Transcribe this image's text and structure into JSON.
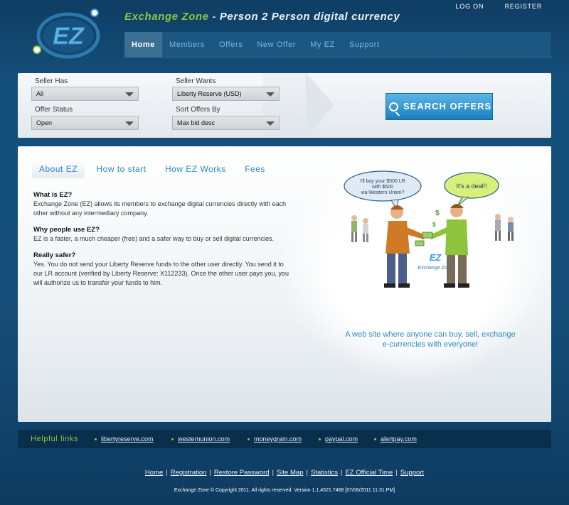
{
  "header": {
    "brand": "Exchange Zone",
    "slogan_sep": " - ",
    "slogan": "Person 2 Person digital currency",
    "logo_text": "EZ",
    "top_links": [
      "LOG ON",
      "REGISTER"
    ]
  },
  "nav": {
    "items": [
      "Home",
      "Members",
      "Offers",
      "New Offer",
      "My EZ",
      "Support"
    ],
    "active": "Home"
  },
  "search": {
    "seller_has_label": "Seller Has",
    "seller_has_value": "All",
    "seller_wants_label": "Seller Wants",
    "seller_wants_value": "Liberty Reserve (USD)",
    "offer_status_label": "Offer Status",
    "offer_status_value": "Open",
    "sort_label": "Sort Offers By",
    "sort_value": "Max bid desc",
    "button": "SEARCH OFFERS"
  },
  "tabs": [
    "About EZ",
    "How to start",
    "How EZ Works",
    "Fees"
  ],
  "faq": [
    {
      "q": "What is EZ?",
      "a": "Exchange Zone (EZ) allows its members to exchange digital currencies directly with each other without any intermediary company."
    },
    {
      "q": "Why people use EZ?",
      "a": "EZ is a faster, a much cheaper (free) and a safer way to buy or sell digital currencies."
    },
    {
      "q": "Really safer?",
      "a": "Yes. You do not send your Liberty Reserve funds to the other user directly. You send it to our LR account (verified by Liberty Reserve: X112233). Once the other user pays you, you will authorize us to transfer your funds to him."
    }
  ],
  "illustration": {
    "bubble_left": [
      "I'll buy your $500 LR",
      "with $500",
      "via Western Union?"
    ],
    "bubble_right": "It's a deal!!",
    "badge": "Exchange Zone",
    "badge_logo": "EZ"
  },
  "tagline": [
    "A web site where anyone can buy, sell, exchange",
    "e-currencies with everyone!"
  ],
  "helpful": {
    "title": "Helpful links",
    "links": [
      "libertyreserve.com",
      "westernunion.com",
      "moneygram.com",
      "paypal.com",
      "alertpay.com"
    ]
  },
  "footer": {
    "links": [
      "Home",
      "Registration",
      "Restore Password",
      "Site Map",
      "Statistics",
      "EZ Official Time",
      "Support"
    ],
    "copyright": "Exchange Zone © Copyright 2011. All rights reserved. Version 1.1.4521.7468 [07/06/2011 11:31 PM]"
  },
  "colors": {
    "background": "#14507c",
    "accent_green": "#8dc63f",
    "accent_blue": "#2a8bc8",
    "nav_active": "#3b6f93"
  }
}
